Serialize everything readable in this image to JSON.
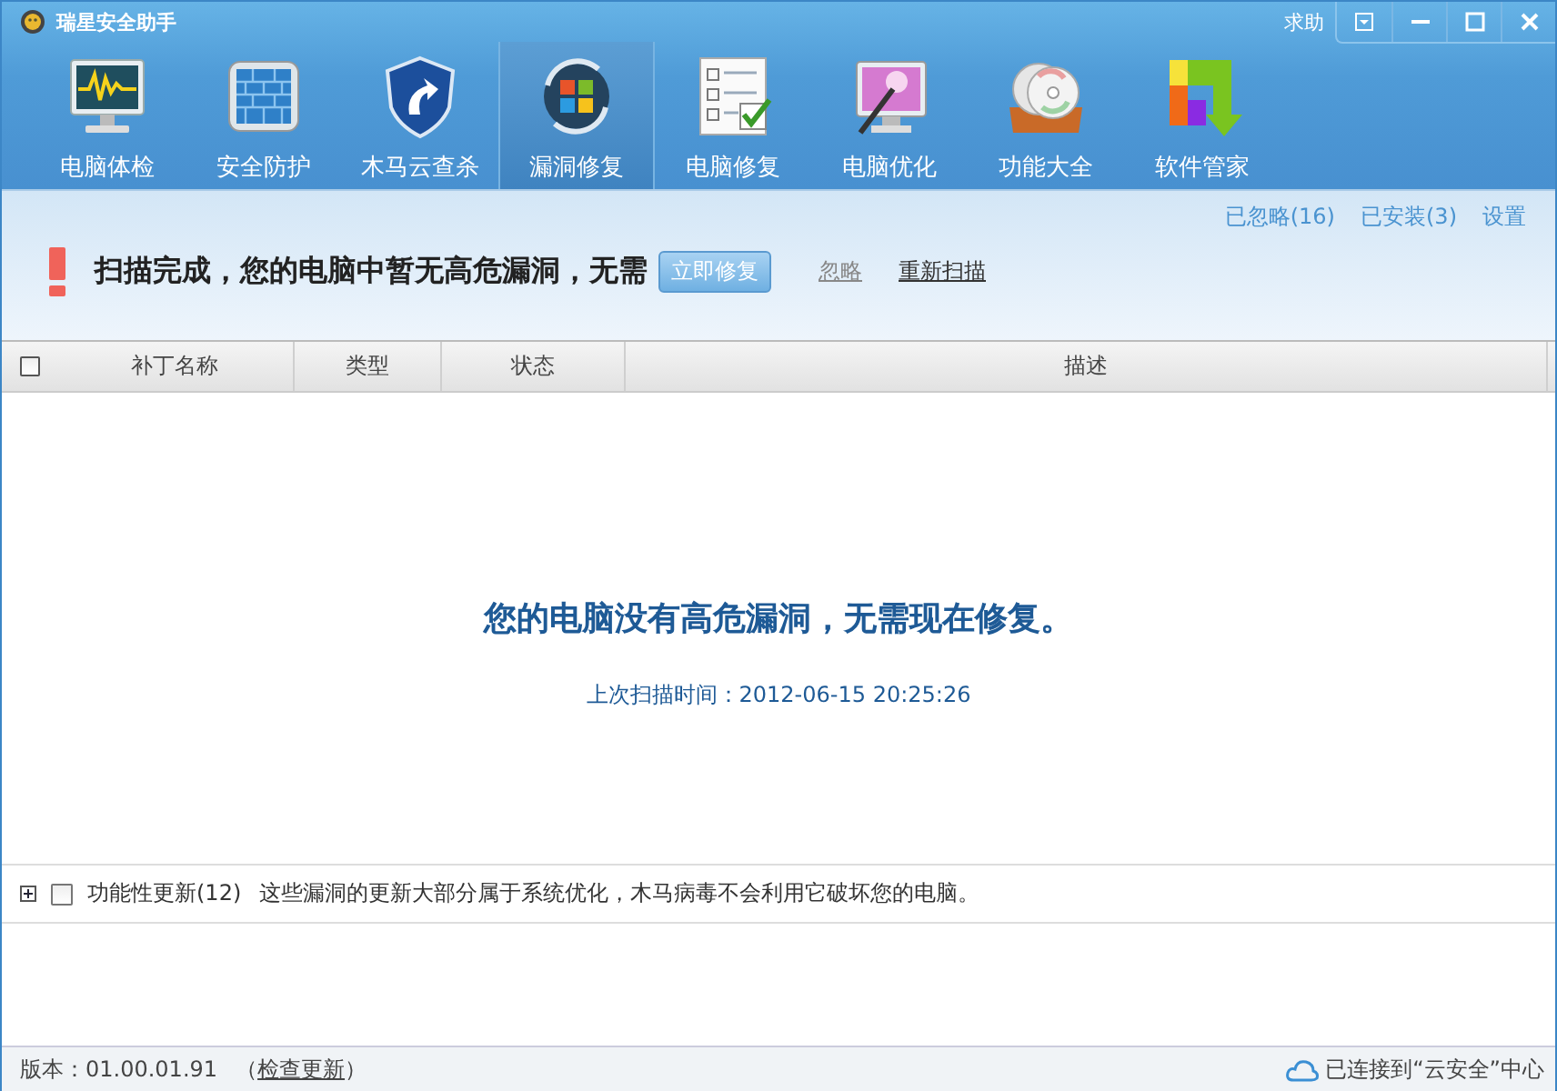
{
  "window": {
    "title": "瑞星安全助手",
    "help": "求助"
  },
  "toolbar": [
    {
      "label": "电脑体检",
      "kind": "monitor",
      "selected": false
    },
    {
      "label": "安全防护",
      "kind": "wall",
      "selected": false
    },
    {
      "label": "木马云查杀",
      "kind": "shield",
      "selected": false
    },
    {
      "label": "漏洞修复",
      "kind": "windows",
      "selected": true
    },
    {
      "label": "电脑修复",
      "kind": "checklist",
      "selected": false
    },
    {
      "label": "电脑优化",
      "kind": "wand",
      "selected": false
    },
    {
      "label": "功能大全",
      "kind": "discs",
      "selected": false
    },
    {
      "label": "软件管家",
      "kind": "blocks",
      "selected": false
    }
  ],
  "banner": {
    "top_links": [
      "已忽略(16)",
      "已安装(3)",
      "设置"
    ],
    "message": "扫描完成，您的电脑中暂无高危漏洞，无需",
    "fix_button": "立即修复",
    "ignore_link": "忽略",
    "rescan_link": "重新扫描"
  },
  "table": {
    "select_all_checked": false,
    "columns": [
      "补丁名称",
      "类型",
      "状态",
      "描述"
    ],
    "empty_title": "您的电脑没有高危漏洞，无需现在修复。",
    "last_scan": "上次扫描时间：2012-06-15 20:25:26"
  },
  "groups": [
    {
      "expanded": false,
      "checked": false,
      "name": "功能性更新(12)",
      "description": "这些漏洞的更新大部分属于系统优化，木马病毒不会利用它破坏您的电脑。"
    }
  ],
  "status_bar": {
    "version": "版本：01.00.01.91",
    "paren_open": "（",
    "check_update": "检查更新",
    "paren_close": "）",
    "cloud": "已连接到“云安全”中心"
  }
}
